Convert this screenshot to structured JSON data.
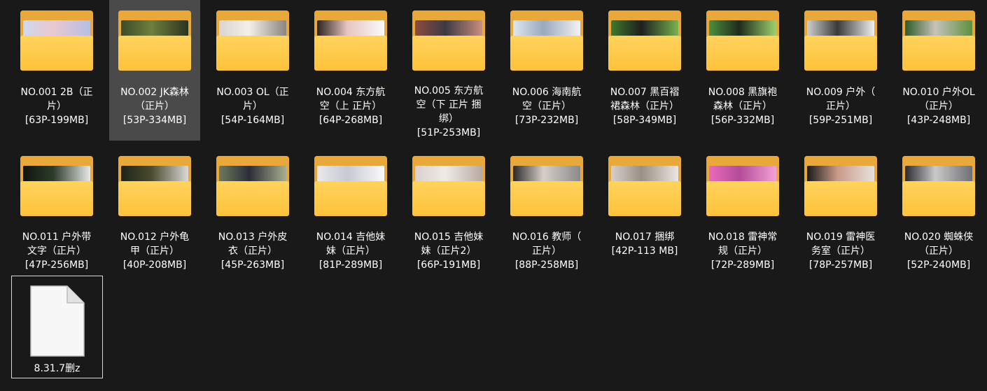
{
  "folders_row1": [
    {
      "label": "NO.001 2B（正片）[63P-199MB]",
      "line1": "NO.001 2B（正",
      "line2": "片）",
      "line3": "[63P-199MB]",
      "thumb": [
        "#cfd7ef",
        "#e9c8cf",
        "#b6bfe6"
      ]
    },
    {
      "label": "NO.002 JK森林（正片）[53P-334MB]",
      "line1": "NO.002 JK森林",
      "line2": "（正片）",
      "line3": "[53P-334MB]",
      "thumb": [
        "#3b4a2a",
        "#6f7f3c",
        "#2c3320"
      ]
    },
    {
      "label": "NO.003 OL（正片）[54P-164MB]",
      "line1": "NO.003 OL（正",
      "line2": "片）",
      "line3": "[54P-164MB]",
      "thumb": [
        "#d9d4cf",
        "#f4efe9",
        "#8b8580"
      ]
    },
    {
      "label": "NO.004 东方航空（上 正片）[64P-268MB]",
      "line1": "NO.004 东方航",
      "line2": "空（上 正片）",
      "line3": "[64P-268MB]",
      "thumb": [
        "#2b2220",
        "#e7c5bf",
        "#fafafa"
      ]
    },
    {
      "label": "NO.005 东方航空（下 正片 捆绑）[51P-253MB]",
      "line1": "NO.005 东方航",
      "line2": "空（下 正片 捆",
      "line3": "绑）",
      "line4": "[51P-253MB]",
      "thumb": [
        "#8e4b3d",
        "#3d3a44",
        "#c98e7e"
      ]
    },
    {
      "label": "NO.006 海南航空（正片）[73P-232MB]",
      "line1": "NO.006 海南航",
      "line2": "空（正片）",
      "line3": "[73P-232MB]",
      "thumb": [
        "#dfe6ef",
        "#9aa9bf",
        "#f2f2f2"
      ]
    },
    {
      "label": "NO.007 黑百褶裙森林（正片）[58P-349MB]",
      "line1": "NO.007 黑百褶",
      "line2": "裙森林（正片）",
      "line3": "[58P-349MB]",
      "thumb": [
        "#3f7a2d",
        "#1e1e1e",
        "#79b24f"
      ]
    },
    {
      "label": "NO.008 黑旗袍森林（正片）[56P-332MB]",
      "line1": "NO.008 黑旗袍",
      "line2": "森林（正片）",
      "line3": "[56P-332MB]",
      "thumb": [
        "#4d8f3b",
        "#1f2a1c",
        "#9fd16e"
      ]
    },
    {
      "label": "NO.009 户外（正片）[59P-251MB]",
      "line1": "NO.009 户外（",
      "line2": "正片）",
      "line3": "[59P-251MB]",
      "thumb": [
        "#cfcfcf",
        "#3a3a3a",
        "#f0f0f0"
      ]
    },
    {
      "label": "NO.010 户外OL（正片）[43P-248MB]",
      "line1": "NO.010 户外OL",
      "line2": "（正片）",
      "line3": "[43P-248MB]",
      "thumb": [
        "#2f5b2a",
        "#c7c2b9",
        "#5e8f40"
      ]
    }
  ],
  "folders_row2": [
    {
      "label": "NO.011 户外带文字（正片）[47P-256MB]",
      "line1": "NO.011 户外带",
      "line2": "文字（正片）",
      "line3": "[47P-256MB]",
      "thumb": [
        "#101410",
        "#2d3c2a",
        "#e9e9e9"
      ]
    },
    {
      "label": "NO.012 户外龟甲（正片）[40P-208MB]",
      "line1": "NO.012 户外龟",
      "line2": "甲（正片）",
      "line3": "[40P-208MB]",
      "thumb": [
        "#1e241a",
        "#4a4a2e",
        "#d9d9d9"
      ]
    },
    {
      "label": "NO.013 户外皮衣（正片）[45P-263MB]",
      "line1": "NO.013 户外皮",
      "line2": "衣（正片）",
      "line3": "[45P-263MB]",
      "thumb": [
        "#6c7a5d",
        "#2b2d3a",
        "#a6b08e"
      ]
    },
    {
      "label": "NO.014 吉他妹妹（正片）[81P-289MB]",
      "line1": "NO.014 吉他妹",
      "line2": "妹（正片）",
      "line3": "[81P-289MB]",
      "thumb": [
        "#e9e9ec",
        "#c7c9d4",
        "#fafafa"
      ]
    },
    {
      "label": "NO.015 吉他妹妹（正片2）[66P-191MB]",
      "line1": "NO.015 吉他妹",
      "line2": "妹（正片2）",
      "line3": "[66P-191MB]",
      "thumb": [
        "#d8d0cc",
        "#f0ebe8",
        "#b8aaa2"
      ]
    },
    {
      "label": "NO.016 教师（正片）[88P-258MB]",
      "line1": "NO.016 教师（",
      "line2": "正片）",
      "line3": "[88P-258MB]",
      "thumb": [
        "#2a2a2a",
        "#d7cfc9",
        "#8a8a8a"
      ]
    },
    {
      "label": "NO.017 捆绑[42P-113 MB]",
      "line1": "NO.017 捆绑",
      "line2": "[42P-113 MB]",
      "thumb": [
        "#d6d0ca",
        "#9a8f86",
        "#ece7e2"
      ]
    },
    {
      "label": "NO.018 雷神常规（正片）[72P-289MB]",
      "line1": "NO.018 雷神常",
      "line2": "规（正片）",
      "line3": "[72P-289MB]",
      "thumb": [
        "#e96ab8",
        "#b44c9a",
        "#f3a0d6"
      ]
    },
    {
      "label": "NO.019 雷神医务室（正片）[78P-257MB]",
      "line1": "NO.019 雷神医",
      "line2": "务室（正片）",
      "line3": "[78P-257MB]",
      "thumb": [
        "#1a1a1a",
        "#c99a89",
        "#e8e1dc"
      ]
    },
    {
      "label": "NO.020 蜘蛛侠（正片）[52P-240MB]",
      "line1": "NO.020 蜘蛛侠",
      "line2": "（正片）",
      "line3": "[52P-240MB]",
      "thumb": [
        "#2a2a30",
        "#c9c9c9",
        "#6f6f74"
      ]
    }
  ],
  "file": {
    "label": "8.31.7删z",
    "icon": "file-icon"
  },
  "selected_index": 1
}
